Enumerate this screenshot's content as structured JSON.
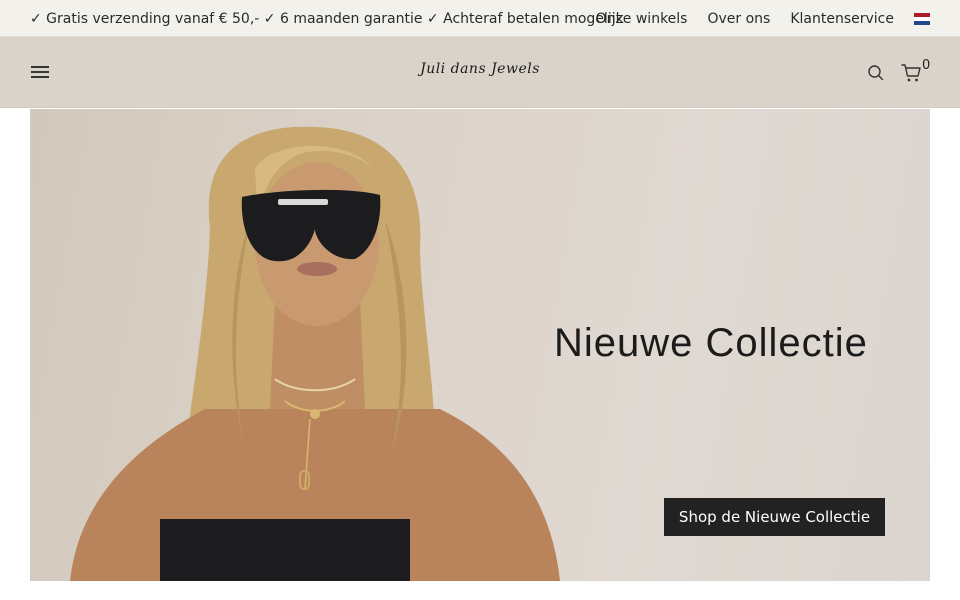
{
  "topbar": {
    "usps": "✓ Gratis verzending vanaf € 50,- ✓ 6 maanden garantie ✓ Achteraf betalen mogelijk",
    "links": [
      {
        "label": "Onze winkels"
      },
      {
        "label": "Over ons"
      },
      {
        "label": "Klantenservice"
      }
    ],
    "flag_colors": [
      "#ae1c28",
      "#ffffff",
      "#21468b"
    ]
  },
  "header": {
    "logo": "Juli dans Jewels",
    "cart_count": "0",
    "icons": [
      "menu-icon",
      "search-icon",
      "cart-icon"
    ]
  },
  "hero": {
    "title": "Nieuwe Collectie",
    "cta_label": "Shop de Nieuwe Collectie"
  },
  "colors": {
    "topbar_bg": "#f3f1ec",
    "header_bg": "#d9d3c9",
    "cta_bg": "#222222",
    "cta_text": "#ffffff"
  }
}
